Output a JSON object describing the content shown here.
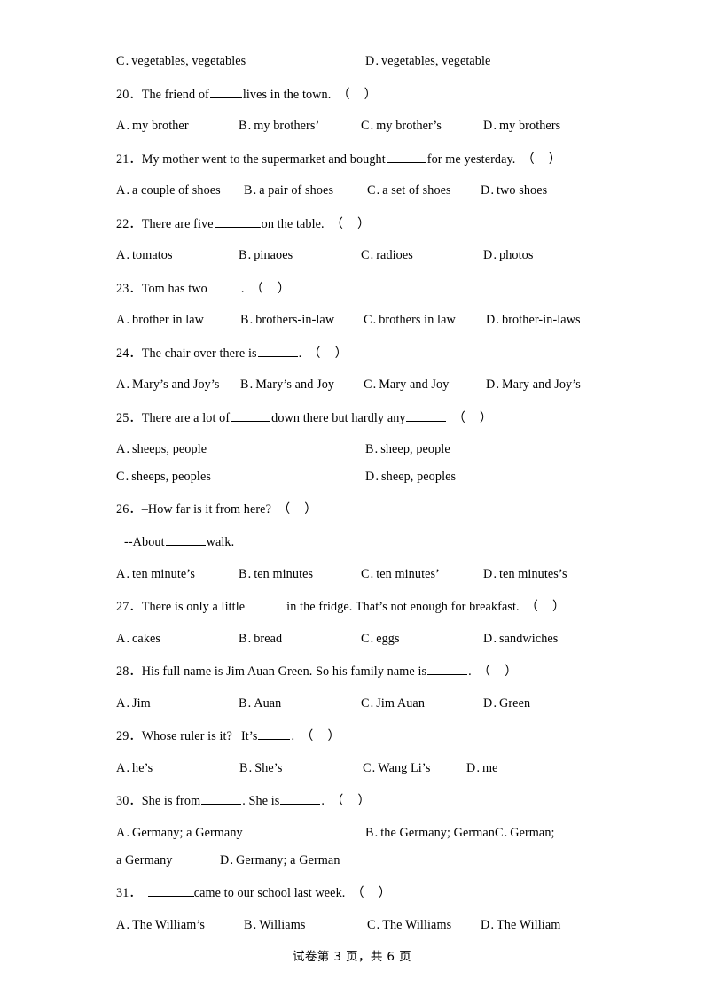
{
  "footer": {
    "text": "试卷第 3 页，共 6 页",
    "page_number": "3",
    "total_pages": "6"
  },
  "questions": [
    {
      "number": "",
      "carryover_options": [
        {
          "label": "C",
          "text": "vegetables, vegetables"
        },
        {
          "label": "D",
          "text": "vegetables, vegetable"
        }
      ]
    },
    {
      "number": "20",
      "stem_before": "The friend of",
      "stem_after": "lives in the town.",
      "options": [
        {
          "label": "A",
          "text": "my brother"
        },
        {
          "label": "B",
          "text": "my brothers’"
        },
        {
          "label": "C",
          "text": "my brother’s"
        },
        {
          "label": "D",
          "text": "my brothers"
        }
      ]
    },
    {
      "number": "21",
      "stem_before": "My mother went to the supermarket and bought",
      "stem_after": "for me yesterday.",
      "options": [
        {
          "label": "A",
          "text": "a couple of shoes"
        },
        {
          "label": "B",
          "text": "a pair of shoes"
        },
        {
          "label": "C",
          "text": "a set of shoes"
        },
        {
          "label": "D",
          "text": "two shoes"
        }
      ]
    },
    {
      "number": "22",
      "stem_before": "There are five",
      "stem_after": "on the table.",
      "options": [
        {
          "label": "A",
          "text": "tomatos"
        },
        {
          "label": "B",
          "text": "pinaoes"
        },
        {
          "label": "C",
          "text": "radioes"
        },
        {
          "label": "D",
          "text": "photos"
        }
      ]
    },
    {
      "number": "23",
      "stem_before": "Tom has two",
      "stem_after": ".",
      "options": [
        {
          "label": "A",
          "text": "brother in law"
        },
        {
          "label": "B",
          "text": "brothers-in-law"
        },
        {
          "label": "C",
          "text": "brothers in law"
        },
        {
          "label": "D",
          "text": "brother-in-laws"
        }
      ]
    },
    {
      "number": "24",
      "stem_before": "The chair over there is",
      "stem_after": ".",
      "options": [
        {
          "label": "A",
          "text": "Mary’s and Joy’s"
        },
        {
          "label": "B",
          "text": "Mary’s and Joy"
        },
        {
          "label": "C",
          "text": "Mary and Joy"
        },
        {
          "label": "D",
          "text": "Mary and Joy’s"
        }
      ]
    },
    {
      "number": "25",
      "stem_before": "There are a lot of",
      "stem_mid": "down there but hardly any",
      "options": [
        {
          "label": "A",
          "text": "sheeps, people"
        },
        {
          "label": "B",
          "text": "sheep, people"
        },
        {
          "label": "C",
          "text": "sheeps, peoples"
        },
        {
          "label": "D",
          "text": "sheep, peoples"
        }
      ]
    },
    {
      "number": "26",
      "stem": "–How far is it from here?",
      "stem_line2_before": "--About",
      "stem_line2_after": "walk.",
      "options": [
        {
          "label": "A",
          "text": "ten minute’s"
        },
        {
          "label": "B",
          "text": "ten minutes"
        },
        {
          "label": "C",
          "text": "ten minutes’"
        },
        {
          "label": "D",
          "text": "ten minutes’s"
        }
      ]
    },
    {
      "number": "27",
      "stem_before": "There is only a little",
      "stem_after": "in the fridge. That’s not enough for breakfast.",
      "options": [
        {
          "label": "A",
          "text": "cakes"
        },
        {
          "label": "B",
          "text": "bread"
        },
        {
          "label": "C",
          "text": "eggs"
        },
        {
          "label": "D",
          "text": "sandwiches"
        }
      ]
    },
    {
      "number": "28",
      "stem_before": "His full name is Jim Auan Green. So his family name is",
      "stem_after": ".",
      "options": [
        {
          "label": "A",
          "text": "Jim"
        },
        {
          "label": "B",
          "text": "Auan"
        },
        {
          "label": "C",
          "text": "Jim Auan"
        },
        {
          "label": "D",
          "text": "Green"
        }
      ]
    },
    {
      "number": "29",
      "stem_before": "Whose ruler is it?",
      "stem_mid": "It’s",
      "stem_after": ".",
      "options": [
        {
          "label": "A",
          "text": "he’s"
        },
        {
          "label": "B",
          "text": "She’s"
        },
        {
          "label": "C",
          "text": "Wang Li’s"
        },
        {
          "label": "D",
          "text": "me"
        }
      ]
    },
    {
      "number": "30",
      "stem_before": "She is from",
      "stem_mid": ". She is",
      "stem_after": ".",
      "options": [
        {
          "label": "A",
          "text": "Germany; a Germany"
        },
        {
          "label": "B",
          "text": "the Germany; German"
        },
        {
          "label": "C",
          "text": "German;"
        },
        {
          "label": "C_cont",
          "text": "a Germany"
        },
        {
          "label": "D",
          "text": "Germany; a German"
        }
      ]
    },
    {
      "number": "31",
      "stem_after": "came to our school last week.",
      "options": [
        {
          "label": "A",
          "text": "The William’s"
        },
        {
          "label": "B",
          "text": "Williams"
        },
        {
          "label": "C",
          "text": "The Williams"
        },
        {
          "label": "D",
          "text": "The William"
        }
      ]
    }
  ]
}
